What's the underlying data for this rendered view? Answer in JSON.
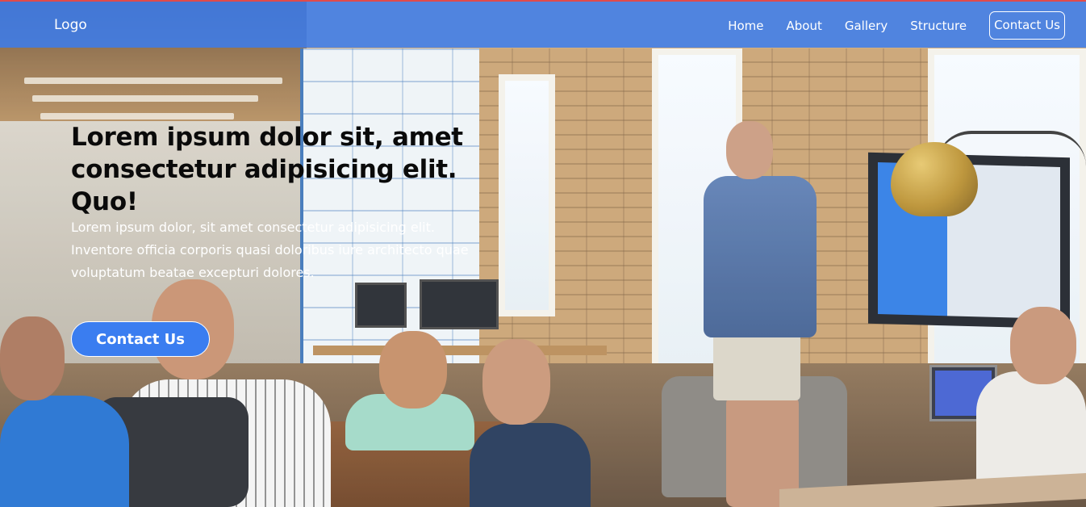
{
  "navbar": {
    "logo": "Logo",
    "links": [
      {
        "label": "Home"
      },
      {
        "label": "About"
      },
      {
        "label": "Gallery"
      },
      {
        "label": "Structure"
      }
    ],
    "contact_label": "Contact Us",
    "background_color": "#3a7df0"
  },
  "hero": {
    "title": "Lorem ipsum dolor sit, amet consectetur adipisicing elit. Quo!",
    "text": "Lorem ipsum dolor, sit amet consectetur adipisicing elit. Inventore officia corporis quasi doloribus iure architecto quae voluptatum beatae excepturi dolores.",
    "button_label": "Contact Us",
    "button_color": "#3a7df0",
    "background_image": "office-meeting-photo"
  }
}
